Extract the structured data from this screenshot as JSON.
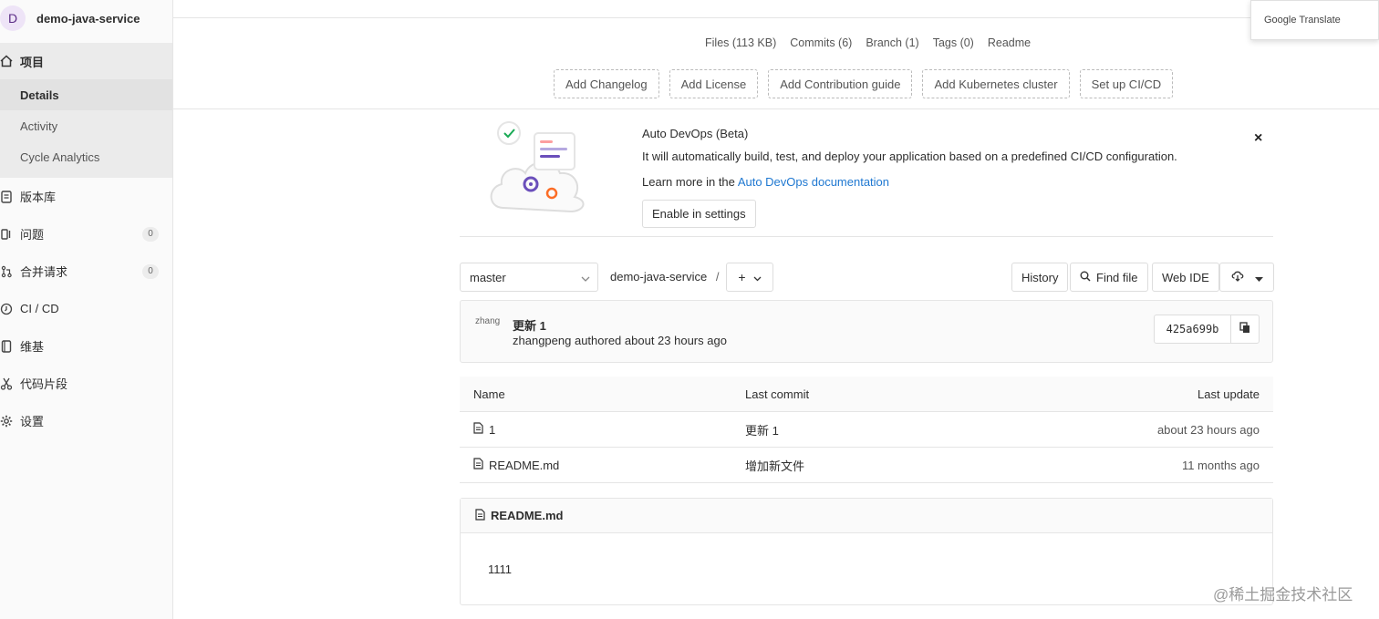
{
  "project": {
    "avatar_letter": "D",
    "name": "demo-java-service"
  },
  "sidebar": {
    "project_label": "项目",
    "sub_items": [
      {
        "label": "Details",
        "active": true
      },
      {
        "label": "Activity"
      },
      {
        "label": "Cycle Analytics"
      }
    ],
    "items": [
      {
        "label": "版本库",
        "icon": "repo-icon"
      },
      {
        "label": "问题",
        "icon": "issues-icon",
        "count": "0"
      },
      {
        "label": "合并请求",
        "icon": "merge-request-icon",
        "count": "0"
      },
      {
        "label": "CI / CD",
        "icon": "rocket-icon"
      },
      {
        "label": "维基",
        "icon": "book-icon"
      },
      {
        "label": "代码片段",
        "icon": "scissors-icon"
      },
      {
        "label": "设置",
        "icon": "gear-icon"
      }
    ]
  },
  "stats": {
    "files": "Files (113 KB)",
    "commits": "Commits (6)",
    "branch": "Branch (1)",
    "tags": "Tags (0)",
    "readme": "Readme"
  },
  "quick_actions": [
    "Add Changelog",
    "Add License",
    "Add Contribution guide",
    "Add Kubernetes cluster",
    "Set up CI/CD"
  ],
  "google_translate": "Google Translate",
  "devops": {
    "title": "Auto DevOps (Beta)",
    "desc": "It will automatically build, test, and deploy your application based on a predefined CI/CD configuration.",
    "learn_prefix": "Learn more in the",
    "learn_link": "Auto DevOps documentation",
    "enable_label": "Enable in settings",
    "close": "×"
  },
  "toolbar": {
    "branch": "master",
    "crumb": "demo-java-service",
    "crumb_sep": "/",
    "plus": "+",
    "history": "History",
    "find_file": "Find file",
    "web_ide": "Web IDE"
  },
  "commit": {
    "avatar_alt": "zhang",
    "title": "更新 1",
    "author": "zhangpeng",
    "meta": "authored about 23 hours ago",
    "sha": "425a699b"
  },
  "table": {
    "headers": {
      "name": "Name",
      "last_commit": "Last commit",
      "last_update": "Last update"
    },
    "rows": [
      {
        "name": "1",
        "commit": "更新 1",
        "update": "about 23 hours ago"
      },
      {
        "name": "README.md",
        "commit": "增加新文件",
        "update": "11 months ago"
      }
    ]
  },
  "readme": {
    "filename": "README.md",
    "content": "1111"
  },
  "watermark": "@稀土掘金技术社区"
}
